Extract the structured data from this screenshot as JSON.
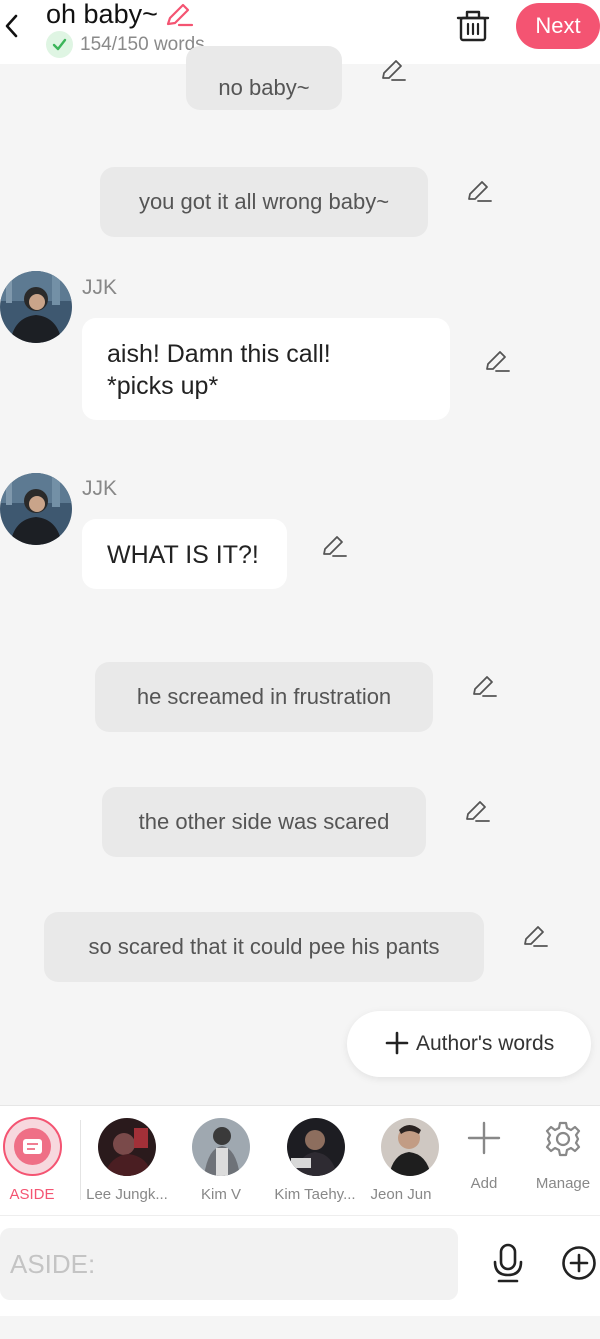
{
  "header": {
    "title": "oh baby~",
    "word_count": "154/150 words",
    "next_label": "Next",
    "accent_color": "#f45472"
  },
  "messages": [
    {
      "type": "narration",
      "text": "no baby~"
    },
    {
      "type": "narration",
      "text": "you got it all wrong baby~"
    },
    {
      "type": "character",
      "name": "JJK",
      "lines": [
        "aish! Damn this call!",
        "*picks up*"
      ]
    },
    {
      "type": "character",
      "name": "JJK",
      "lines": [
        "WHAT IS IT?!"
      ]
    },
    {
      "type": "narration",
      "text": "he screamed in frustration"
    },
    {
      "type": "narration",
      "text": "the other side was scared"
    },
    {
      "type": "narration",
      "text": "so scared that it could pee his pants"
    }
  ],
  "authors_words_label": "Author's words",
  "characters": [
    {
      "label": "ASIDE",
      "selected": true
    },
    {
      "label": "Lee Jungk..."
    },
    {
      "label": "Kim V"
    },
    {
      "label": "Kim Taehy..."
    },
    {
      "label": "Jeon Jun"
    },
    {
      "label": "Add"
    },
    {
      "label": "Manage"
    }
  ],
  "input": {
    "placeholder": "ASIDE:"
  }
}
